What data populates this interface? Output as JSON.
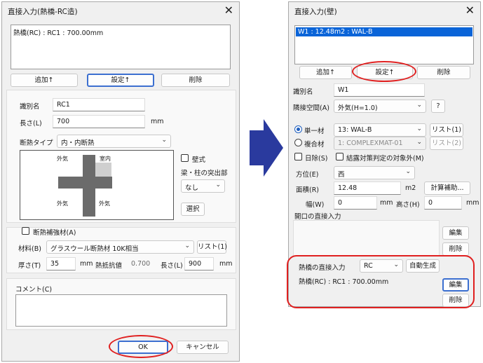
{
  "left_dialog": {
    "title": "直接入力(熱橋-RC造)",
    "close_glyph": "✕",
    "list_items": [
      "熱橋(RC) : RC1 : 700.00mm"
    ],
    "add_button": "追加↑",
    "set_button": "設定↑",
    "delete_button": "削除",
    "id_label": "識別名",
    "id_value": "RC1",
    "length_label": "長さ(L)",
    "length_value": "700",
    "length_unit": "mm",
    "insulation_type_label": "断熱タイプ",
    "insulation_type_value": "内・内断熱",
    "diagram": {
      "outside_tl": "外気",
      "inside_tr": "室内",
      "outside_bl": "外気",
      "outside_br": "外気"
    },
    "wall_type_label": "壁式",
    "protrusion_label": "梁・柱の突出部",
    "protrusion_value": "なし",
    "select_button": "選択",
    "reinforce_label": "断熱補強材(A)",
    "material_label": "材料(B)",
    "material_value": "グラスウール断熱材 10K相当",
    "list_button": "リスト(1)",
    "thickness_label": "厚さ(T)",
    "thickness_value": "35",
    "thickness_unit": "mm",
    "resistance_label": "熱抵抗値",
    "resistance_value": "0.700",
    "length2_label": "長さ(L)",
    "length2_value": "900",
    "length2_unit": "mm",
    "comment_label": "コメント(C)",
    "ok_button": "OK",
    "cancel_button": "キャンセル"
  },
  "right_dialog": {
    "title": "直接入力(壁)",
    "close_glyph": "✕",
    "list_items": [
      "W1 : 12.48m2 : WAL-B"
    ],
    "add_button": "追加↑",
    "set_button": "設定↑",
    "delete_button": "削除",
    "id_label": "識別名",
    "id_value": "W1",
    "adjacent_label": "隣接空間(A)",
    "adjacent_value": "外気(H=1.0)",
    "help_button": "?",
    "single_label": "単一材",
    "single_value": "13: WAL-B",
    "single_list_button": "リスト(1)",
    "composite_label": "複合材",
    "composite_value": "1: COMPLEXMAT-01",
    "composite_list_button": "リスト(2)",
    "sun_label": "日除(S)",
    "condensation_label": "結露対策判定の対象外(M)",
    "direction_label": "方位(E)",
    "direction_value": "西",
    "area_label": "面積(R)",
    "area_value": "12.48",
    "area_unit": "m2",
    "calc_button": "計算補助...",
    "width_label": "幅(W)",
    "width_value": "0",
    "width_unit": "mm",
    "height_label": "高さ(H)",
    "height_value": "0",
    "height_unit": "mm",
    "opening_label": "開口の直接入力",
    "edit_button": "編集",
    "opening_delete_button": "削除",
    "thermal_bridge_label": "熱橋の直接入力",
    "thermal_bridge_value": "RC",
    "auto_button": "自動生成",
    "thermal_bridge_item": "熱橋(RC) : RC1 : 700.00mm",
    "tb_edit_button": "編集",
    "tb_delete_button": "削除"
  },
  "colors": {
    "highlight_red": "#e02020",
    "selection_blue": "#0a64d8",
    "arrow_blue": "#2a3a9e",
    "wall_gray": "#6b6b6b"
  }
}
